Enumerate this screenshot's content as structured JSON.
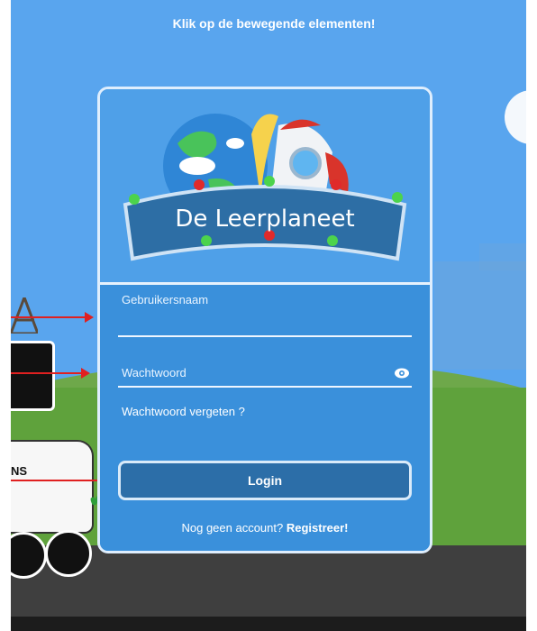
{
  "hint": {
    "text": "Klik op de bewegende elementen!"
  },
  "logo": {
    "text": "De Leerplaneet"
  },
  "form": {
    "username_label": "Gebruikersnaam",
    "username_value": "",
    "password_label": "Wachtwoord",
    "password_value": "",
    "show_password_icon": "eye-icon",
    "forgot_password": "Wachtwoord vergeten ?",
    "login_label": "Login",
    "no_account_text": "Nog geen account? ",
    "register_label": "Registreer!"
  },
  "background": {
    "car_label": "NS"
  },
  "colors": {
    "sky": "#59a5ee",
    "card": "#3a90db",
    "button": "#2c6ea8",
    "grass": "#5fa23c",
    "road": "#3f3f3f",
    "arrow": "#e02020"
  }
}
